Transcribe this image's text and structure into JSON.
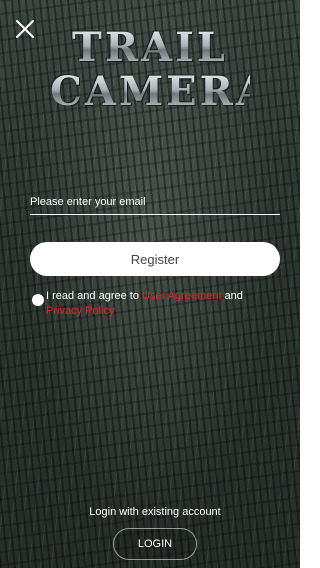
{
  "header": {
    "close_icon": "close-icon"
  },
  "logo": {
    "line1": "TRAIL",
    "line2": "CAMERA"
  },
  "form": {
    "email_placeholder": "Please enter your email",
    "email_value": "",
    "register_label": "Register"
  },
  "agreement": {
    "checked": false,
    "text_before": "I read and agree to ",
    "user_agreement": "User Agreement",
    "text_middle": " and ",
    "privacy_policy": "Privacy Policy",
    "link_color": "#e32222"
  },
  "footer": {
    "prompt": "Login with existing account",
    "login_label": "LOGIN"
  }
}
